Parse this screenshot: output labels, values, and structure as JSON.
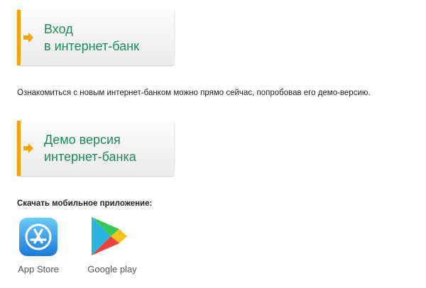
{
  "login_button": {
    "line1": "Вход",
    "line2": "в интернет-банк"
  },
  "info_text": "Ознакомиться с новым интернет-банком можно прямо сейчас, попробовав его демо-версию.",
  "demo_button": {
    "line1": "Демо версия",
    "line2": "интернет-банка"
  },
  "download": {
    "title": "Скачать мобильное приложение:",
    "stores": [
      {
        "label": "App Store",
        "icon": "app-store-icon"
      },
      {
        "label": "Google play",
        "icon": "google-play-icon"
      }
    ]
  },
  "colors": {
    "accent_stripe": "#f5a300",
    "label_text": "#1e8a5d"
  }
}
